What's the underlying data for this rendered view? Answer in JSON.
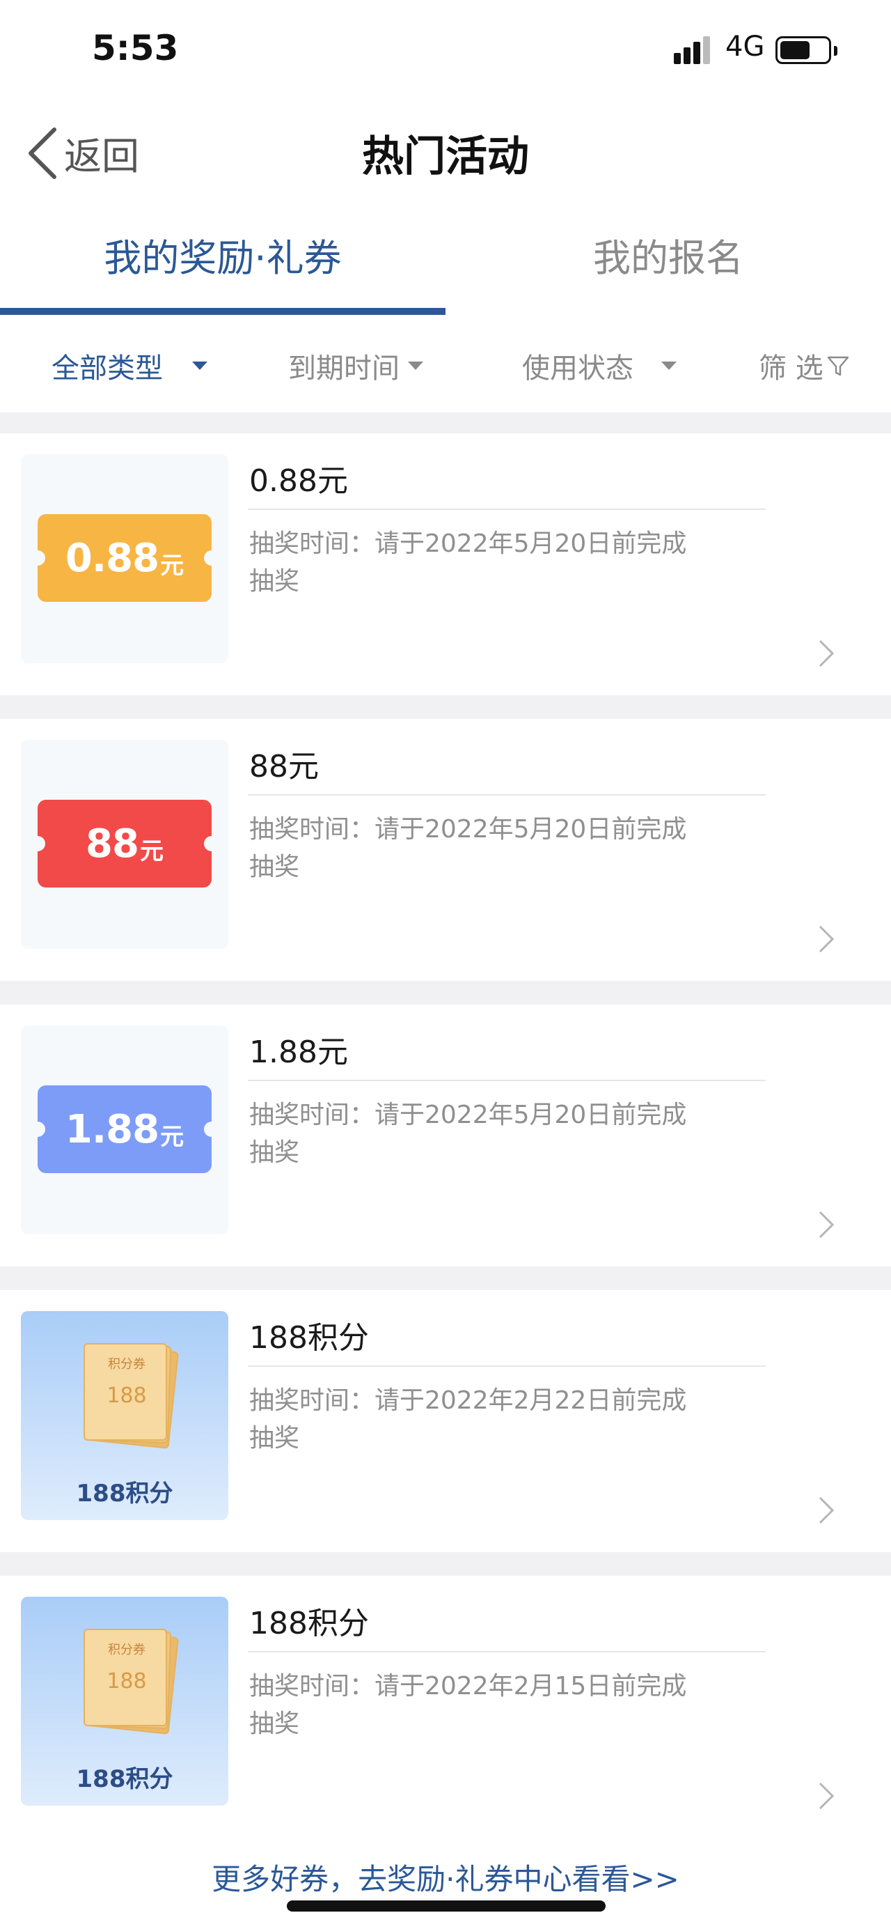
{
  "status_bar": {
    "time": "5:53",
    "network": "4G"
  },
  "nav": {
    "back_label": "返回",
    "title": "热门活动"
  },
  "tabs": [
    {
      "label": "我的奖励·礼券",
      "active": true
    },
    {
      "label": "我的报名",
      "active": false
    }
  ],
  "filters": [
    {
      "label": "全部类型",
      "active": true
    },
    {
      "label": "到期时间",
      "active": false
    },
    {
      "label": "使用状态",
      "active": false
    },
    {
      "label": "筛 选",
      "active": false
    }
  ],
  "rewards": [
    {
      "title": "0.88元",
      "ticket_amount": "0.88",
      "ticket_unit": "元",
      "ticket_color": "#f7b544",
      "desc": "抽奖时间：请于2022年5月20日前完成抽奖"
    },
    {
      "title": "88元",
      "ticket_amount": "88",
      "ticket_unit": "元",
      "ticket_color": "#f24a48",
      "desc": "抽奖时间：请于2022年5月20日前完成抽奖"
    },
    {
      "title": "1.88元",
      "ticket_amount": "1.88",
      "ticket_unit": "元",
      "ticket_color": "#7d9cf7",
      "desc": "抽奖时间：请于2022年5月20日前完成抽奖"
    },
    {
      "title": "188积分",
      "points_header": "积分券",
      "points_value": "188",
      "points_caption": "188积分",
      "desc": "抽奖时间：请于2022年2月22日前完成抽奖"
    },
    {
      "title": "188积分",
      "points_header": "积分券",
      "points_value": "188",
      "points_caption": "188积分",
      "desc": "抽奖时间：请于2022年2月15日前完成抽奖"
    }
  ],
  "footer": {
    "link_text": "更多好券，去奖励·礼券中心看看>>"
  },
  "colors": {
    "accent": "#2b5896",
    "muted": "#8a8a8a"
  }
}
